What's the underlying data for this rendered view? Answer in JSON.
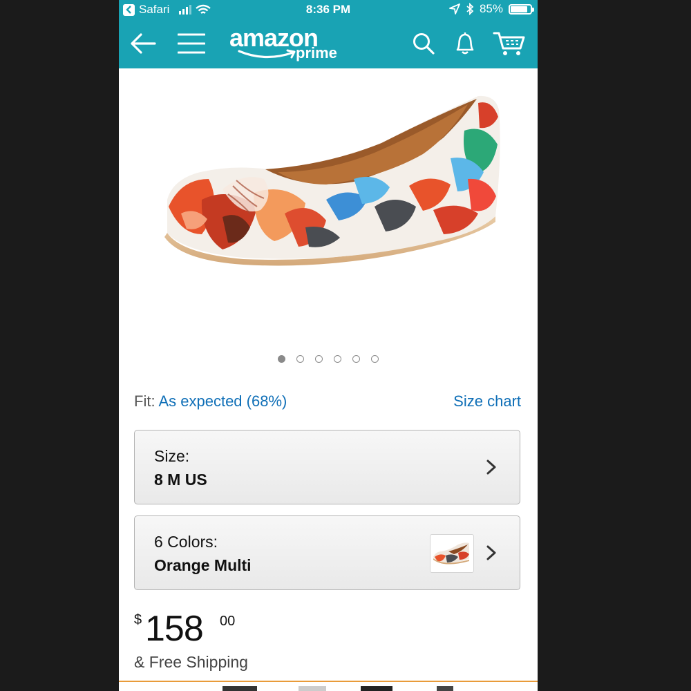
{
  "status_bar": {
    "back_app": "Safari",
    "time": "8:36 PM",
    "battery": "85%",
    "battery_level": 0.85
  },
  "nav": {
    "logo_word": "amazon",
    "logo_sub": "prime",
    "icons": [
      "back-arrow-icon",
      "menu-icon",
      "search-icon",
      "bell-icon",
      "cart-icon"
    ],
    "accent_color": "#19a3b4"
  },
  "gallery": {
    "image_count": 6,
    "active_index": 0
  },
  "fit": {
    "label": "Fit:",
    "value": "As expected (68%)",
    "size_chart": "Size chart"
  },
  "size": {
    "label": "Size:",
    "value": "8 M US"
  },
  "color": {
    "label": "6 Colors:",
    "value": "Orange Multi"
  },
  "price": {
    "symbol": "$",
    "whole": "158",
    "fraction": "00",
    "shipping": "& Free Shipping"
  }
}
